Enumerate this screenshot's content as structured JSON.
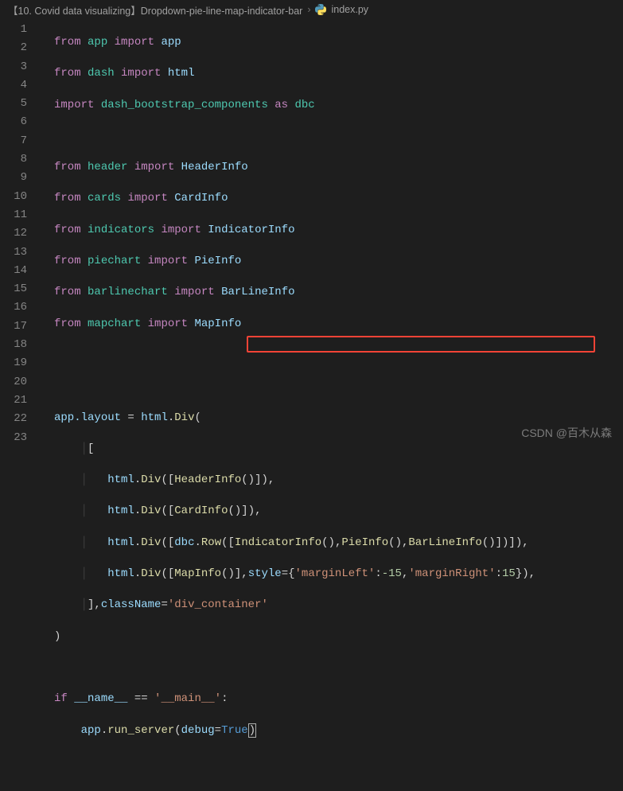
{
  "breadcrumb": {
    "seg1": "【10. Covid data visualizing】Dropdown-pie-line-map-indicator-bar",
    "seg2": "index.py",
    "sep": "›"
  },
  "lines": {
    "count": 23
  },
  "code": {
    "l1_from": "from",
    "l1_app": "app",
    "l1_import": "import",
    "l1_app2": "app",
    "l2_from": "from",
    "l2_dash": "dash",
    "l2_import": "import",
    "l2_html": "html",
    "l3_import": "import",
    "l3_dbc": "dash_bootstrap_components",
    "l3_as": "as",
    "l3_alias": "dbc",
    "l5_from": "from",
    "l5_header": "header",
    "l5_import": "import",
    "l5_HeaderInfo": "HeaderInfo",
    "l6_from": "from",
    "l6_cards": "cards",
    "l6_import": "import",
    "l6_CardInfo": "CardInfo",
    "l7_from": "from",
    "l7_indicators": "indicators",
    "l7_import": "import",
    "l7_IndicatorInfo": "IndicatorInfo",
    "l8_from": "from",
    "l8_piechart": "piechart",
    "l8_import": "import",
    "l8_PieInfo": "PieInfo",
    "l9_from": "from",
    "l9_barlinechart": "barlinechart",
    "l9_import": "import",
    "l9_BarLineInfo": "BarLineInfo",
    "l10_from": "from",
    "l10_mapchart": "mapchart",
    "l10_import": "import",
    "l10_MapInfo": "MapInfo",
    "l13_app": "app",
    "l13_layout": ".layout",
    "l13_eq": " = ",
    "l13_html": "html",
    "l13_Div": "Div",
    "l14_bracket": "[",
    "l15_html": "html",
    "l15_Div": "Div",
    "l15_HeaderInfo": "HeaderInfo",
    "l16_html": "html",
    "l16_Div": "Div",
    "l16_CardInfo": "CardInfo",
    "l17_html": "html",
    "l17_Div": "Div",
    "l17_dbc": "dbc",
    "l17_Row": "Row",
    "l17_IndicatorInfo": "IndicatorInfo",
    "l17_PieInfo": "PieInfo",
    "l17_BarLineInfo": "BarLineInfo",
    "l18_html": "html",
    "l18_Div": "Div",
    "l18_MapInfo": "MapInfo",
    "l18_style": "style",
    "l18_mL": "'marginLeft'",
    "l18_mLv": "-15",
    "l18_mR": "'marginRight'",
    "l18_mRv": "15",
    "l19_className": "className",
    "l19_val": "'div_container'",
    "l22_if": "if",
    "l22_name": "__name__",
    "l22_eq": " == ",
    "l22_main": "'__main__'",
    "l23_app": "app",
    "l23_run": "run_server",
    "l23_debug": "debug",
    "l23_True": "True"
  },
  "highlight": {
    "line_from": 18,
    "line_to": 18
  },
  "watermark": "CSDN @百木从森"
}
